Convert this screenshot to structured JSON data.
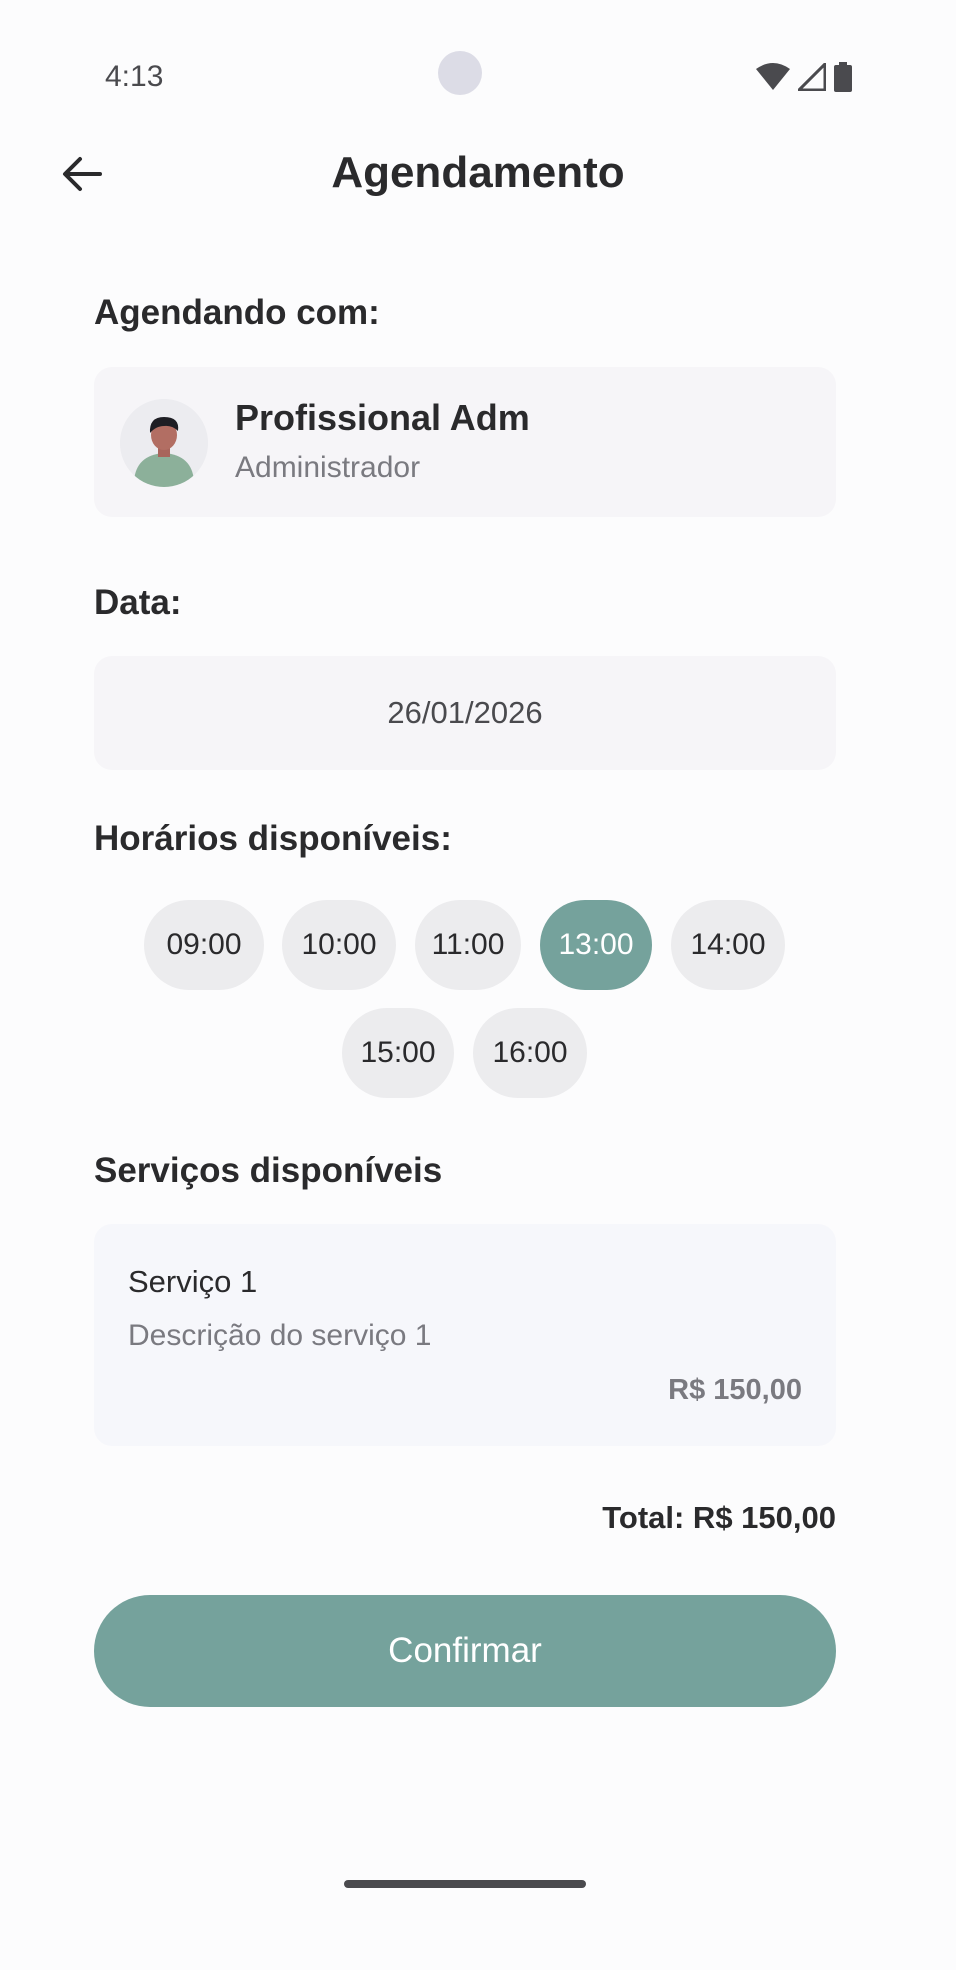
{
  "status_bar": {
    "time": "4:13"
  },
  "header": {
    "title": "Agendamento"
  },
  "professional": {
    "section_label": "Agendando com:",
    "name": "Profissional Adm",
    "role": "Administrador"
  },
  "date": {
    "section_label": "Data:",
    "value": "26/01/2026"
  },
  "times": {
    "section_label": "Horários disponíveis:",
    "slots": [
      "09:00",
      "10:00",
      "11:00",
      "13:00",
      "14:00",
      "15:00",
      "16:00"
    ],
    "selected": "13:00"
  },
  "services": {
    "section_label": "Serviços disponíveis",
    "items": [
      {
        "name": "Serviço 1",
        "description": "Descrição do serviço 1",
        "price": "R$ 150,00"
      }
    ]
  },
  "total_label": "Total: R$ 150,00",
  "confirm_label": "Confirmar",
  "colors": {
    "accent": "#75a29c",
    "card_bg": "#f6f5f8",
    "slot_bg": "#ececee"
  }
}
